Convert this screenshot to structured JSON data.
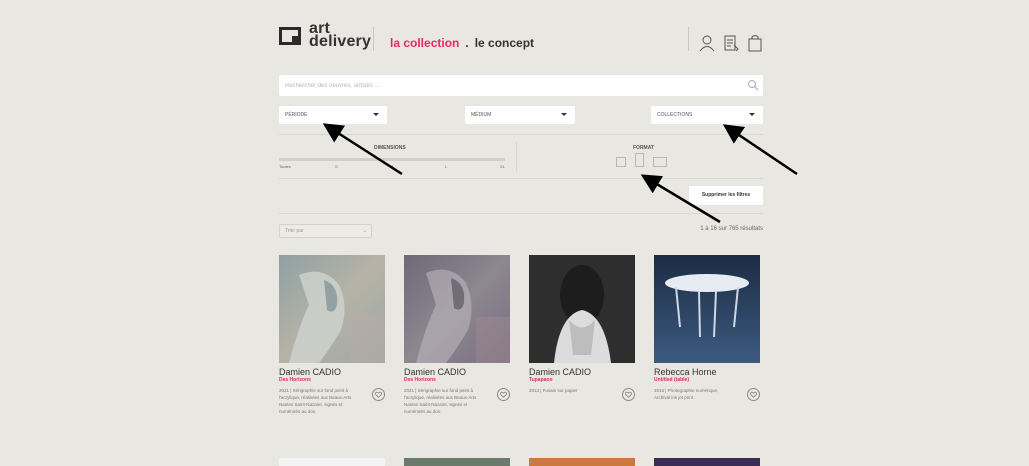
{
  "header": {
    "logo_line1": "art",
    "logo_line2": "delivery",
    "nav": {
      "collection": "la collection",
      "dot": ".",
      "concept": "le concept"
    },
    "icons": [
      "user-icon",
      "cart-list-icon",
      "bag-icon"
    ]
  },
  "search": {
    "placeholder": "Rechercher des oeuvres, artistes ..."
  },
  "filters": {
    "periode": "PÉRIODE",
    "medium": "MÉDIUM",
    "collections": "COLLECTIONS",
    "dimensions_title": "DIMENSIONS",
    "dimensions_labels": [
      "Toutes",
      "S",
      "M",
      "L",
      "XL"
    ],
    "format_title": "FORMAT",
    "clear_label": "Supprimer les filtres"
  },
  "listing": {
    "sort_label": "Trier par",
    "results": "1 à 16 sur 765 résultats"
  },
  "cards": [
    {
      "artist": "Damien CADIO",
      "title": "Des Horizons",
      "desc": "2021 | Sérigraphie sur fond peint à l'acrylique, réalisées aux Beaux-Arts Nantes Saint-Nazaire, signés et numérotés au dos."
    },
    {
      "artist": "Damien CADIO",
      "title": "Des Horizons",
      "desc": "2021 | Sérigraphie sur fond peint à l'acrylique, réalisées aux Beaux-Arts Nantes Saint-Nazaire, signés et numérotés au dos."
    },
    {
      "artist": "Damien CADIO",
      "title": "Tupapaoo",
      "desc": "2013 | Fusain sur papier"
    },
    {
      "artist": "Rebecca Horne",
      "title": "Untitled (table)",
      "desc": "2015 | Photographie numérique, Archival ink jet print"
    }
  ],
  "colors": {
    "accent": "#e62a64",
    "background": "#e8e7e1",
    "arrow": "#000000"
  }
}
